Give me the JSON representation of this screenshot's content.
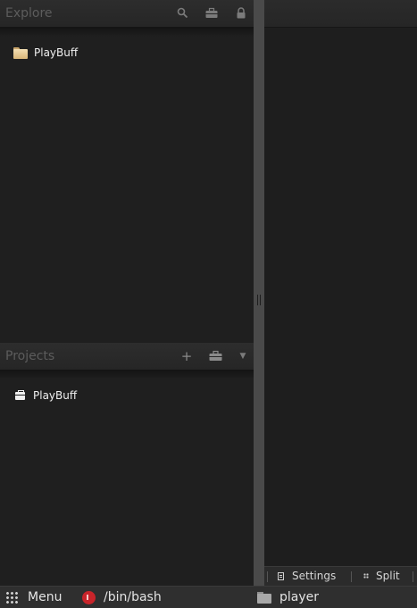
{
  "explore": {
    "title": "Explore",
    "icons": [
      "search-icon",
      "briefcase-icon",
      "lock-icon"
    ],
    "items": [
      {
        "label": "PlayBuff",
        "icon": "folder-icon"
      }
    ]
  },
  "projects": {
    "title": "Projects",
    "icons": [
      "plus-icon",
      "briefcase-icon",
      "dropdown-arrow-icon"
    ],
    "items": [
      {
        "label": "PlayBuff",
        "icon": "briefcase-icon"
      }
    ]
  },
  "editor": {
    "statusbar": {
      "settings_label": "Settings",
      "split_label": "Split"
    }
  },
  "taskbar": {
    "menu_label": "Menu",
    "terminal_label": "/bin/bash",
    "folder_label": "player"
  },
  "colors": {
    "background": "#1e1e1e",
    "splitter": "#4a4a4a",
    "header_text": "#5c5c5c",
    "folder": "#e5c58e",
    "terminal_icon": "#c8242a"
  }
}
